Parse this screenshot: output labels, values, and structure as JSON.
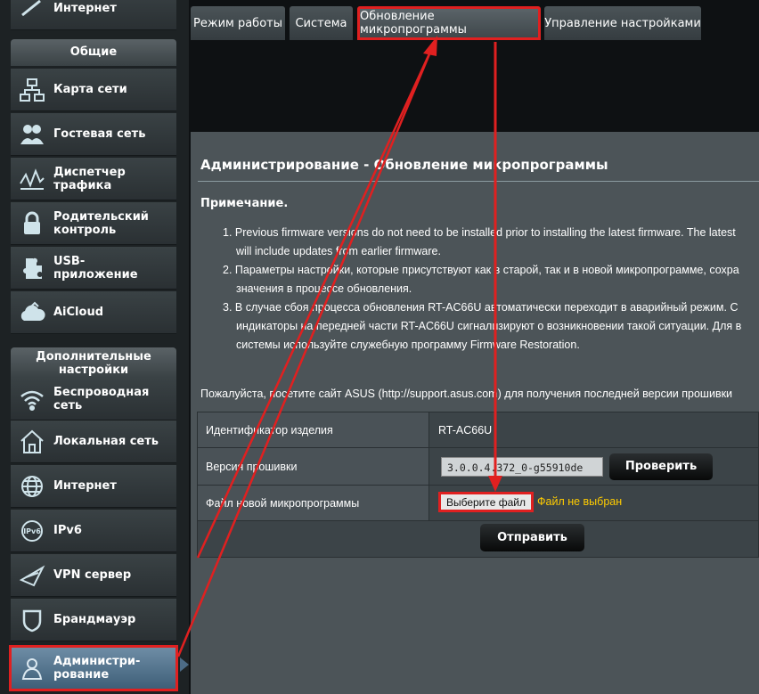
{
  "sidebar": {
    "top_item": "Интернет",
    "general_header": "Общие",
    "general_items": [
      {
        "label": "Карта сети",
        "icon": "network-map-icon"
      },
      {
        "label": "Гостевая сеть",
        "icon": "guest-network-icon"
      },
      {
        "label": "Диспетчер трафика",
        "icon": "traffic-manager-icon"
      },
      {
        "label": "Родительский контроль",
        "icon": "parental-control-icon"
      },
      {
        "label": "USB-приложение",
        "icon": "usb-app-icon"
      },
      {
        "label": "AiCloud",
        "icon": "aicloud-icon"
      }
    ],
    "advanced_header": "Дополнительные настройки",
    "advanced_items": [
      {
        "label": "Беспроводная сеть",
        "icon": "wireless-icon"
      },
      {
        "label": "Локальная сеть",
        "icon": "lan-icon"
      },
      {
        "label": "Интернет",
        "icon": "internet-icon"
      },
      {
        "label": "IPv6",
        "icon": "ipv6-icon"
      },
      {
        "label": "VPN сервер",
        "icon": "vpn-icon"
      },
      {
        "label": "Брандмауэр",
        "icon": "firewall-icon"
      },
      {
        "label": "Администри-рование",
        "icon": "admin-icon"
      }
    ]
  },
  "tabs": [
    "Режим работы",
    "Система",
    "Обновление микропрограммы",
    "Управление настройками"
  ],
  "main": {
    "title": "Администрирование - Обновление микропрограммы",
    "note_header": "Примечание.",
    "notes": [
      [
        "1. Previous firmware versions do not need to be installed prior to installing the latest firmware. The latest",
        "will include updates from earlier firmware."
      ],
      [
        "2. Параметры настройки, которые присутствуют как в старой, так и в новой микропрограмме, сохра",
        "значения в процессе обновления."
      ],
      [
        "3. В случае сбоя процесса обновления RT-AC66U автоматически переходит в аварийный режим. С",
        "индикаторы на передней части RT-AC66U сигнализируют о возникновении такой ситуации. Для в",
        "системы используйте служебную программу Firmware Restoration."
      ]
    ],
    "visit_text": "Пожалуйста, посетите сайт ASUS (http://support.asus.com) для получения последней версии прошивки",
    "table": {
      "product_id_label": "Идентификатор изделия",
      "product_id_value": "RT-AC66U",
      "fw_version_label": "Версия прошивки",
      "fw_version_value": "3.0.0.4.372_0-g55910de",
      "check_button": "Проверить",
      "new_fw_label": "Файл новой микропрограммы",
      "choose_file_button": "Выберите файл",
      "no_file_text": "Файл не выбран",
      "submit_button": "Отправить"
    }
  },
  "colors": {
    "highlight": "#e02020",
    "warning_text": "#ffcc00",
    "panel": "#4c5458"
  }
}
